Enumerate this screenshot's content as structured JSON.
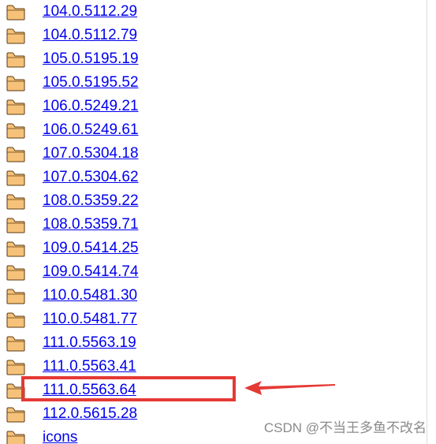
{
  "directory": {
    "entries": [
      {
        "label": "104.0.5112.29"
      },
      {
        "label": "104.0.5112.79"
      },
      {
        "label": "105.0.5195.19"
      },
      {
        "label": "105.0.5195.52"
      },
      {
        "label": "106.0.5249.21"
      },
      {
        "label": "106.0.5249.61"
      },
      {
        "label": "107.0.5304.18"
      },
      {
        "label": "107.0.5304.62"
      },
      {
        "label": "108.0.5359.22"
      },
      {
        "label": "108.0.5359.71"
      },
      {
        "label": "109.0.5414.25"
      },
      {
        "label": "109.0.5414.74"
      },
      {
        "label": "110.0.5481.30"
      },
      {
        "label": "110.0.5481.77"
      },
      {
        "label": "111.0.5563.19"
      },
      {
        "label": "111.0.5563.41"
      },
      {
        "label": "111.0.5563.64",
        "highlighted": true
      },
      {
        "label": "112.0.5615.28"
      },
      {
        "label": "icons"
      }
    ]
  },
  "annotation": {
    "highlight_color": "#e53935",
    "arrow_direction": "left"
  },
  "watermark": {
    "text": "CSDN @不当王多鱼不改名"
  },
  "colors": {
    "link": "#0000ee",
    "folder_fill": "#f6c27a",
    "folder_outline": "#5a3a10"
  },
  "icons": {
    "entry_icon": "folder-icon"
  }
}
